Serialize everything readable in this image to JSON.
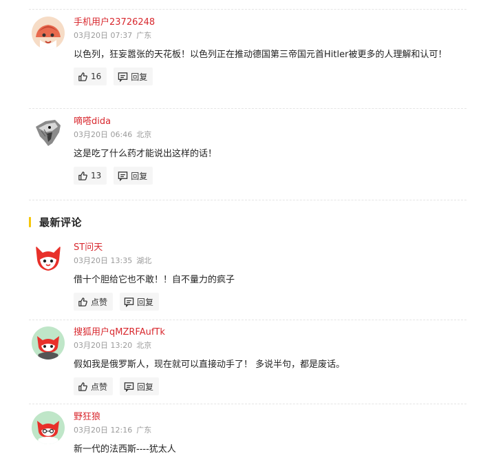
{
  "hot_comments": [
    {
      "username": "手机用户23726248",
      "time": "03月20日 07:37",
      "location": "广东",
      "content": "以色列，狂妄嚣张的天花板！以色列正在推动德国第三帝国元首Hitler被更多的人理解和认可！",
      "like_label": "16",
      "reply_label": "回复"
    },
    {
      "username": "嘀嗒dida",
      "time": "03月20日 06:46",
      "location": "北京",
      "content": "这是吃了什么药才能说出这样的话！",
      "like_label": "13",
      "reply_label": "回复"
    }
  ],
  "section": {
    "title": "最新评论"
  },
  "latest_comments": [
    {
      "username": "ST问天",
      "time": "03月20日 13:35",
      "location": "湖北",
      "content": "借十个胆给它也不敢！！自不量力的疯子",
      "like_label": "点赞",
      "reply_label": "回复"
    },
    {
      "username": "搜狐用户qMZRFAufTk",
      "time": "03月20日 13:20",
      "location": "北京",
      "content": "假如我是俄罗斯人，现在就可以直接动手了！ 多说半句，都是废话。",
      "like_label": "点赞",
      "reply_label": "回复"
    },
    {
      "username": "野狂狼",
      "time": "03月20日 12:16",
      "location": "广东",
      "content": "新一代的法西斯----犹太人"
    }
  ],
  "colors": {
    "username": "#d8282e",
    "accent_bar": "#f5c60a",
    "meta": "#9a9a9a",
    "button_bg": "#f5f5f5"
  },
  "icons": {
    "like": "thumb-up-icon",
    "reply": "comment-icon"
  }
}
